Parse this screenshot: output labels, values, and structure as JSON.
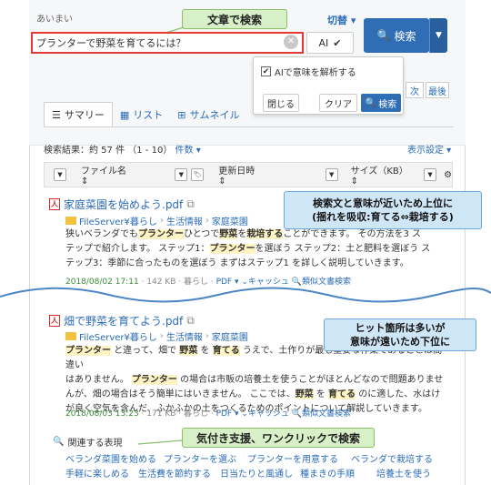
{
  "header": {
    "aimai_label": "あいまい",
    "switch_label": "切替 ▾"
  },
  "search": {
    "value": "プランターで野菜を育てるには？",
    "ai_label": "AI",
    "button_label": "検索"
  },
  "callouts": {
    "search_by_sentence": "文章で検索",
    "rank_up_1": "検索文と意味が近いため上位に",
    "rank_up_2": "(揺れを吸収:育てる⇔栽培する)",
    "rank_down_1": "ヒット箇所は多いが",
    "rank_down_2": "意味が遠いため下位に",
    "one_click": "気付き支援、ワンクリックで検索"
  },
  "ai_dropdown": {
    "checkbox_label": "AIで意味を解析する",
    "close": "閉じる",
    "clear": "クリア",
    "search": "検索"
  },
  "pager": {
    "next": "次",
    "last": "最後"
  },
  "tabs": [
    {
      "label": "サマリー"
    },
    {
      "label": "リスト"
    },
    {
      "label": "サムネイル"
    }
  ],
  "results_info": {
    "count_text": "検索結果：約 57 件 （1 - 10）",
    "count_dropdown": "件数 ▾",
    "display_settings": "表示設定 ▾"
  },
  "columns": {
    "filename": "ファイル名",
    "updated": "更新日時",
    "size": "サイズ（KB）"
  },
  "results": [
    {
      "title": "家庭菜園を始めよう.pdf",
      "crumbs": [
        "FileServer¥暮らし",
        "生活情報",
        "家庭菜園"
      ],
      "snippet": [
        [
          "狭いベランダでも",
          ""
        ],
        [
          "プランター",
          "h"
        ],
        [
          "ひとつで",
          ""
        ],
        [
          "野菜",
          "h"
        ],
        [
          "を",
          ""
        ],
        [
          "栽培する",
          "h"
        ],
        [
          "ことができます。 その方法を3 ス",
          ""
        ],
        [
          "\nテップで紹介します。 ステップ1：",
          ""
        ],
        [
          "プランター",
          "h"
        ],
        [
          "を選ぼう ステップ2：土と肥料を選ぼう ス",
          ""
        ],
        [
          "\nテップ3：季節に合ったものを選ぼう まずはステップ1 を詳しく説明していきます。",
          ""
        ]
      ],
      "meta": {
        "date": "2018/08/02 17:11",
        "rest": "· 142 KB · 暮らし ·",
        "pdf": "PDF ▾",
        "cache": "キャッシュ",
        "similar": "類似文書検索"
      }
    },
    {
      "title": "畑で野菜を育てよう.pdf",
      "crumbs": [
        "FileServer¥暮らし",
        "生活情報",
        "家庭菜園"
      ],
      "snippet": [
        [
          "プランター",
          "h"
        ],
        [
          " と違って、畑で ",
          ""
        ],
        [
          "野菜",
          "h"
        ],
        [
          " を ",
          ""
        ],
        [
          "育てる",
          "h"
        ],
        [
          " うえで、土作りが最も重要な作業であることは間違い",
          ""
        ],
        [
          "\nはありません。 ",
          ""
        ],
        [
          "プランター",
          "h"
        ],
        [
          " の場合は市販の培養土を使うことがほとんどなので問題ありませ",
          ""
        ],
        [
          "\nんが、畑の場合はそう簡単にはいきません。 ここでは、",
          ""
        ],
        [
          "野菜",
          "h"
        ],
        [
          " を ",
          ""
        ],
        [
          "育てる",
          "h"
        ],
        [
          " のに適した、水はけ",
          ""
        ],
        [
          "\nが良く空気を含んだ、ふかふかの土をつくるためのポイントについて解説していきます。",
          ""
        ]
      ],
      "meta": {
        "date": "2018/08/03 13:23",
        "rest": "· 171 KB · 暮らし ·",
        "pdf": "PDF ▾",
        "cache": "キャッシュ",
        "similar": "類似文書検索"
      }
    }
  ],
  "related": {
    "heading": "関連する表現",
    "row1": [
      "ベランダ菜園を始める",
      "プランターを選ぶ",
      "プランターを用意する",
      "ベランダで栽培する"
    ],
    "row2": [
      "手軽に楽しめる",
      "生活費を節約する",
      "日当たりと風通し",
      "種まきの手順",
      "培養土を使う"
    ]
  },
  "colors": {
    "accent": "#2f6db5",
    "highlight": "#fff3c4",
    "callout_green": "#d8f0c8",
    "callout_blue": "#cfe6f7",
    "input_border": "#e53935"
  }
}
